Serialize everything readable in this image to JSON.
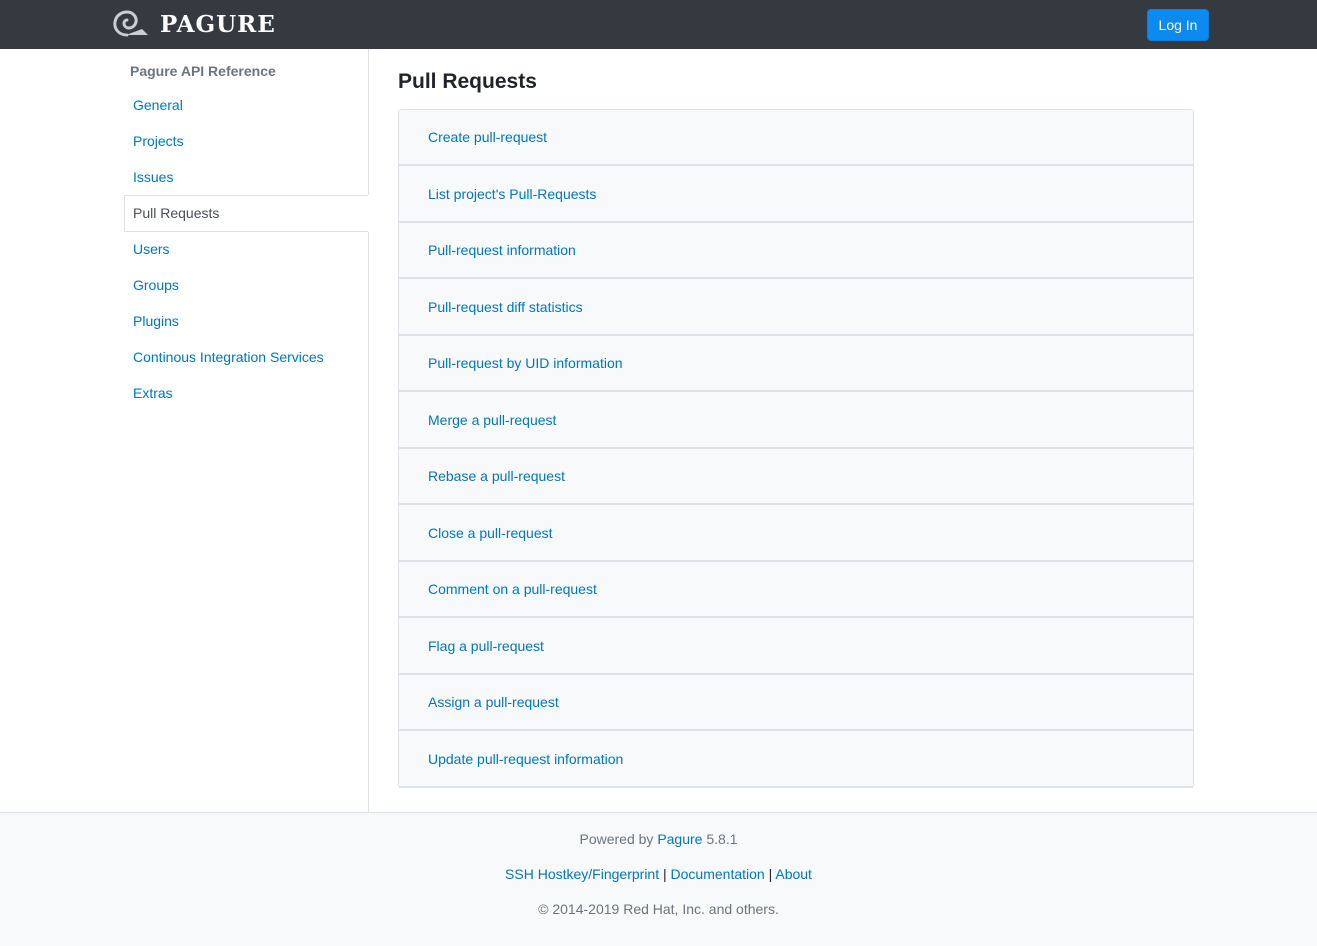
{
  "navbar": {
    "brand": "PAGURE",
    "login_label": "Log In"
  },
  "sidebar": {
    "heading": "Pagure API Reference",
    "items": [
      {
        "label": "General"
      },
      {
        "label": "Projects"
      },
      {
        "label": "Issues"
      },
      {
        "label": "Pull Requests",
        "active": true
      },
      {
        "label": "Users"
      },
      {
        "label": "Groups"
      },
      {
        "label": "Plugins"
      },
      {
        "label": "Continous Integration Services"
      },
      {
        "label": "Extras"
      }
    ]
  },
  "main": {
    "title": "Pull Requests",
    "endpoints": [
      {
        "label": "Create pull-request"
      },
      {
        "label": "List project's Pull-Requests"
      },
      {
        "label": "Pull-request information"
      },
      {
        "label": "Pull-request diff statistics"
      },
      {
        "label": "Pull-request by UID information"
      },
      {
        "label": "Merge a pull-request"
      },
      {
        "label": "Rebase a pull-request"
      },
      {
        "label": "Close a pull-request"
      },
      {
        "label": "Comment on a pull-request"
      },
      {
        "label": "Flag a pull-request"
      },
      {
        "label": "Assign a pull-request"
      },
      {
        "label": "Update pull-request information"
      }
    ]
  },
  "footer": {
    "powered_prefix": "Powered by",
    "powered_link": "Pagure",
    "version": "5.8.1",
    "ssh_link": "SSH Hostkey/Fingerprint",
    "separator": "|",
    "docs_link": "Documentation",
    "about_link": "About",
    "copyright": "© 2014-2019 Red Hat, Inc. and others."
  },
  "colors": {
    "navbar": "#343a40",
    "link": "#0277bd",
    "button": "#0d8af0"
  }
}
